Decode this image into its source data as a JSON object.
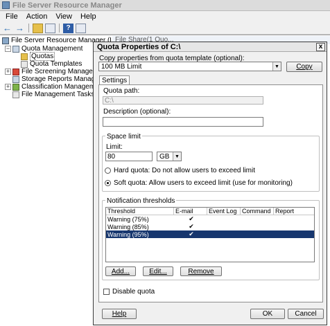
{
  "app": {
    "title": "File Server Resource Manager"
  },
  "menu": [
    "File",
    "Action",
    "View",
    "Help"
  ],
  "tree": {
    "root": "File Server Resource Manager (Local)",
    "quota_management": "Quota Management",
    "quotas": "Quotas",
    "quota_templates": "Quota Templates",
    "file_screening": "File Screening Management",
    "storage_reports": "Storage Reports Management",
    "classification": "Classification Management",
    "file_management_tasks": "File Management Tasks"
  },
  "right_pane_tab": "File Share(1 Quo...",
  "dialog": {
    "title": "Quota Properties of C:\\",
    "copy_label": "Copy properties from quota template (optional):",
    "template_value": "100 MB Limit",
    "copy_button": "Copy",
    "tab_settings": "Settings",
    "quota_path_label": "Quota path:",
    "quota_path_value": "C:\\",
    "description_label": "Description (optional):",
    "description_value": "",
    "space_limit_legend": "Space limit",
    "limit_label": "Limit:",
    "limit_value": "80",
    "limit_unit": "GB",
    "hard_quota": "Hard quota: Do not allow users to exceed limit",
    "soft_quota": "Soft quota: Allow users to exceed limit (use for monitoring)",
    "notification_legend": "Notification thresholds",
    "columns": [
      "Threshold",
      "E-mail",
      "Event Log",
      "Command",
      "Report"
    ],
    "rows": [
      {
        "threshold": "Warning (75%)",
        "email": "✔",
        "selected": false
      },
      {
        "threshold": "Warning (85%)",
        "email": "✔",
        "selected": false
      },
      {
        "threshold": "Warning (95%)",
        "email": "✔",
        "selected": true
      }
    ],
    "add_button": "Add...",
    "edit_button": "Edit...",
    "remove_button": "Remove",
    "disable_quota": "Disable quota",
    "help_button": "Help",
    "ok_button": "OK",
    "cancel_button": "Cancel",
    "close_glyph": "x"
  }
}
